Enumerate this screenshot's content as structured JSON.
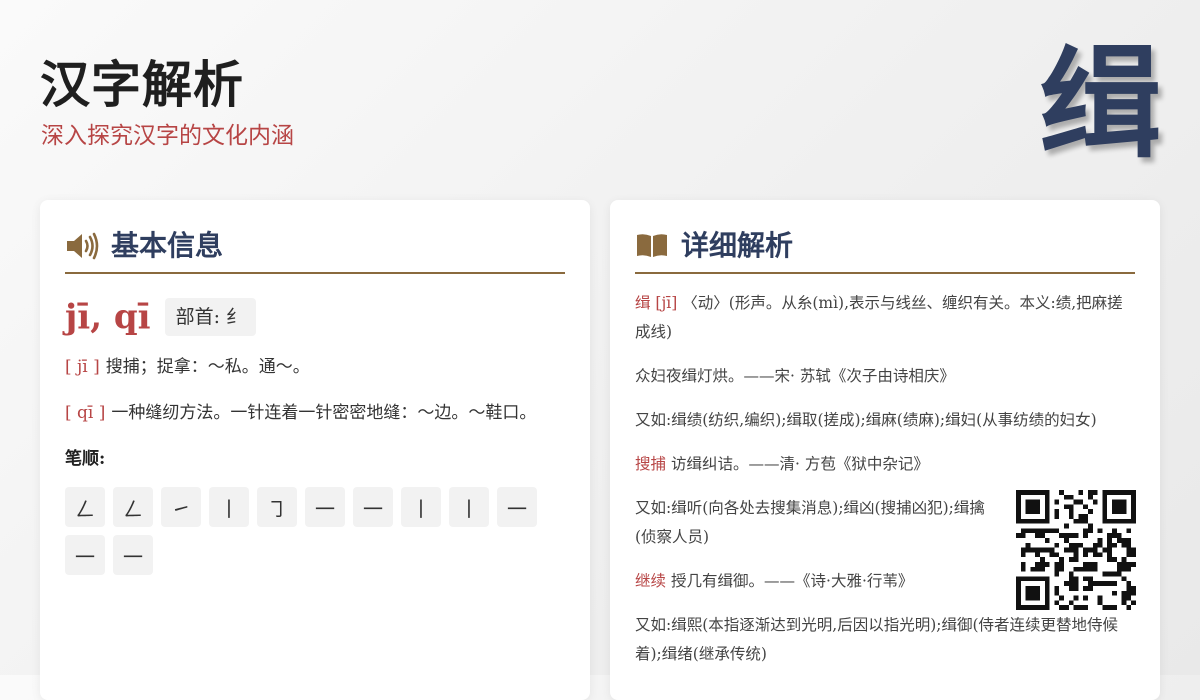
{
  "header": {
    "title": "汉字解析",
    "subtitle": "深入探究汉字的文化内涵",
    "character": "缉"
  },
  "basic": {
    "title": "基本信息",
    "icon": "speaker-icon",
    "pinyin": "jī, qī",
    "radical": "部首: 纟",
    "definitions": [
      {
        "py": "[ jī ]",
        "text": "搜捕；捉拿：～私。通～。"
      },
      {
        "py": "[ qī ]",
        "text": "一种缝纫方法。一针连着一针密密地缝：～边。～鞋口。"
      }
    ],
    "stroke_label": "笔顺:",
    "strokes": [
      "ㄥ",
      "ㄥ",
      "㇀",
      "丨",
      "㇆",
      "一",
      "一",
      "丨",
      "丨",
      "一",
      "一",
      "一"
    ]
  },
  "detail": {
    "title": "详细解析",
    "icon": "book-icon",
    "entry1": {
      "hl": "缉 [jī]",
      "text": "〈动〉(形声。从糸(mì),表示与线丝、缠织有关。本义:绩,把麻搓成线)"
    },
    "quote1": "众妇夜缉灯烘。——宋· 苏轼《次子由诗相庆》",
    "example1": "又如:缉绩(纺织,编织);缉取(搓成);缉麻(绩麻);缉妇(从事纺绩的妇女)",
    "entry2": {
      "hl": "搜捕",
      "text": "访缉纠诘。——清· 方苞《狱中杂记》"
    },
    "example2": "又如:缉听(向各处去搜集消息);缉凶(搜捕凶犯);缉擒(侦察人员)",
    "entry3": {
      "hl": "继续",
      "text": "授几有缉御。——《诗·大雅·行苇》"
    },
    "example3": "又如:缉熙(本指逐渐达到光明,后因以指光明);缉御(侍者连续更替地侍候着);缉绪(继承传统)"
  },
  "colors": {
    "accent_red": "#b74545",
    "title_navy": "#2f3e5f",
    "rule_brown": "#8a6a3e"
  }
}
